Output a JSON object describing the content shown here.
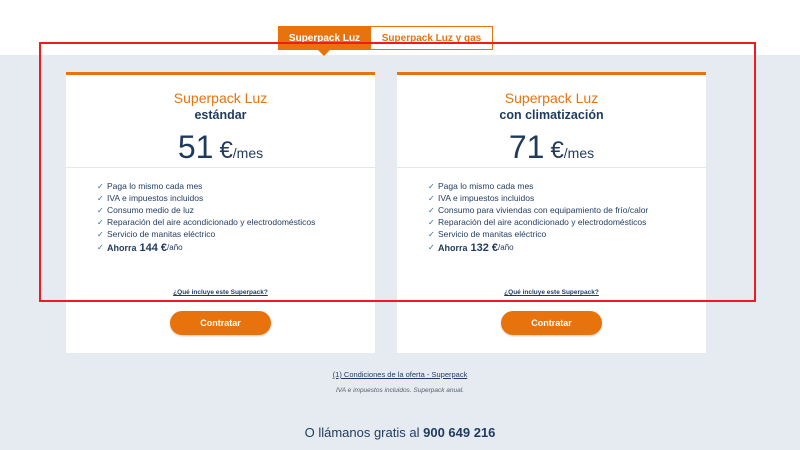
{
  "tabs": [
    {
      "label": "Superpack Luz",
      "active": true
    },
    {
      "label": "Superpack Luz y gas",
      "active": false
    }
  ],
  "plans": [
    {
      "title": "Superpack Luz",
      "subtitle": "estándar",
      "price_amount": "51",
      "price_currency": "€",
      "price_period": "/mes",
      "features": [
        "Paga lo mismo cada mes",
        "IVA e impuestos incluidos",
        "Consumo medio de luz",
        "Reparación del aire acondicionado y electrodomésticos",
        "Servicio de manitas eléctrico"
      ],
      "savings_label": "Ahorra",
      "savings_value": "144 €",
      "savings_period": "/año",
      "info_link": "¿Qué incluye este Superpack?",
      "cta_label": "Contratar"
    },
    {
      "title": "Superpack Luz",
      "subtitle": "con climatización",
      "price_amount": "71",
      "price_currency": "€",
      "price_period": "/mes",
      "features": [
        "Paga lo mismo cada mes",
        "IVA e impuestos incluidos",
        "Consumo para viviendas con equipamiento de frío/calor",
        "Reparación del aire acondicionado y electrodomésticos",
        "Servicio de manitas eléctrico"
      ],
      "savings_label": "Ahorra",
      "savings_value": "132 €",
      "savings_period": "/año",
      "info_link": "¿Qué incluye este Superpack?",
      "cta_label": "Contratar"
    }
  ],
  "footer": {
    "conditions_link": "(1) Condiciones de la oferta - Superpack",
    "iva_note": "IVA e impuestos incluidos. Superpack anual.",
    "phone_prefix": "O llámanos gratis al",
    "phone_number": "900 649 216"
  },
  "icons": {
    "check": "check-icon"
  },
  "colors": {
    "accent": "#e8730c",
    "text_dark": "#1f3a5f",
    "band_bg": "#e6ebf1",
    "highlight": "#ee1c1c"
  }
}
